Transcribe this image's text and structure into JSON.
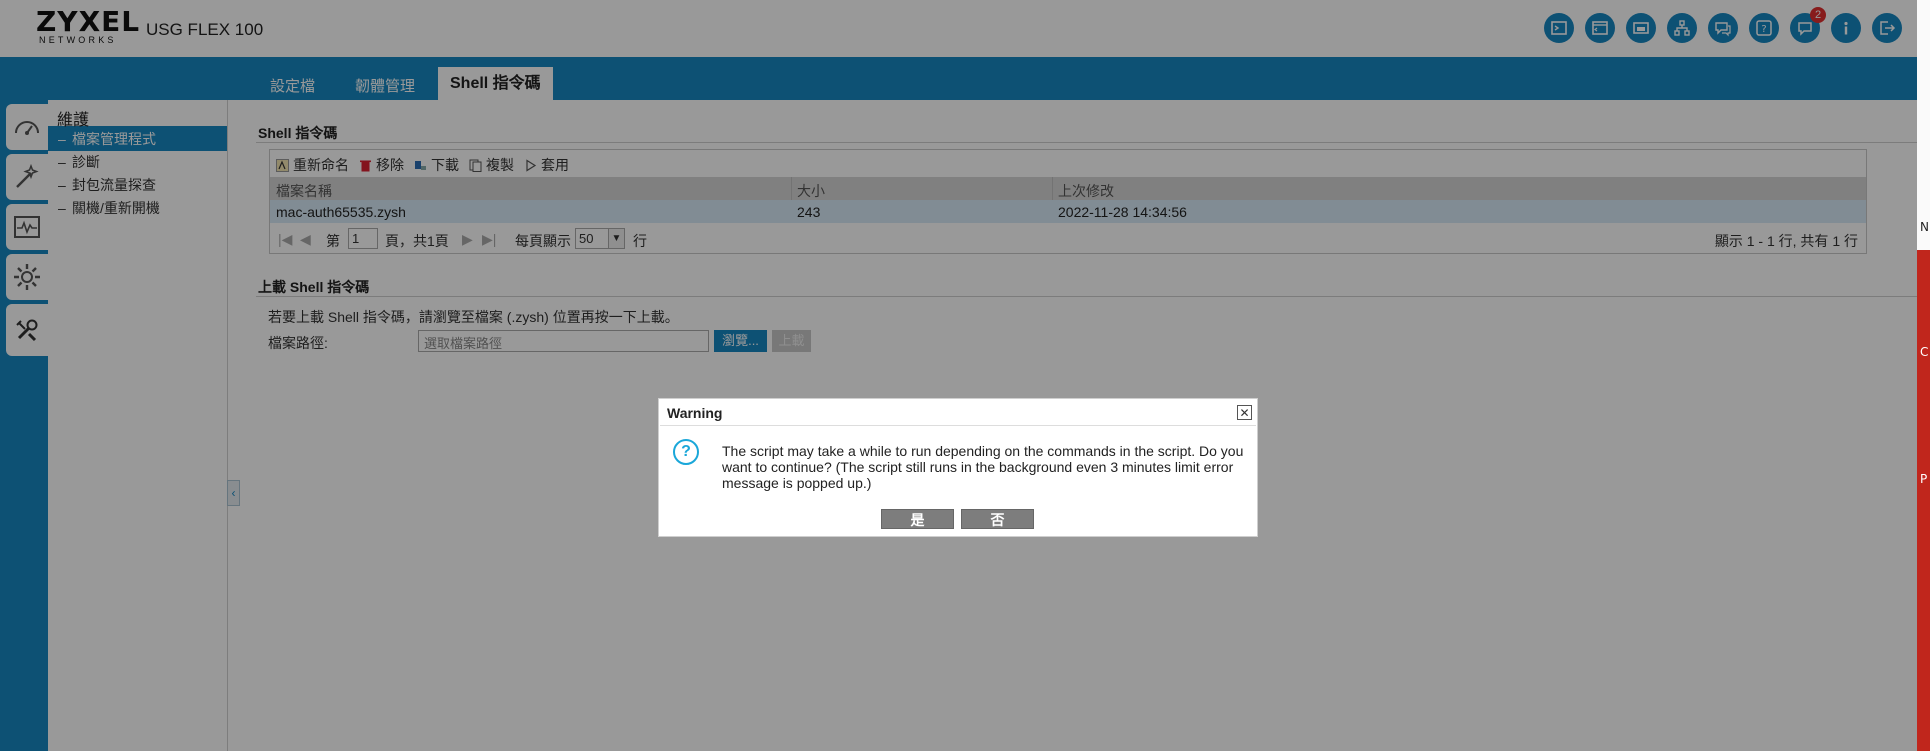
{
  "header": {
    "brand": "ZYXEL",
    "brand_sub": "NETWORKS",
    "model": "USG FLEX 100",
    "notification_count": "2",
    "icons": [
      "console-icon",
      "cli-icon",
      "window-icon",
      "network-icon",
      "chat-icon",
      "help-icon",
      "notification-icon",
      "info-icon",
      "logout-icon"
    ]
  },
  "tabs": [
    {
      "label": "設定檔"
    },
    {
      "label": "韌體管理"
    },
    {
      "label": "Shell 指令碼"
    }
  ],
  "sidebar": {
    "title": "維護",
    "items": [
      {
        "label": "檔案管理程式",
        "active": true
      },
      {
        "label": "診斷"
      },
      {
        "label": "封包流量探查"
      },
      {
        "label": "關機/重新開機"
      }
    ],
    "rail_icons": [
      "dashboard-icon",
      "wizard-icon",
      "monitor-icon",
      "settings-icon",
      "maintenance-icon"
    ]
  },
  "shell_section": {
    "title": "Shell 指令碼",
    "toolbar": {
      "rename": "重新命名",
      "remove": "移除",
      "download": "下載",
      "copy": "複製",
      "apply": "套用"
    },
    "columns": [
      "檔案名稱",
      "大小",
      "上次修改"
    ],
    "rows": [
      {
        "name": "mac-auth65535.zysh",
        "size": "243",
        "modified": "2022-11-28 14:34:56"
      }
    ],
    "pager": {
      "page_label": "第",
      "page_value": "1",
      "page_suffix": "頁，共1頁",
      "per_page_label": "每頁顯示",
      "per_page_value": "50",
      "per_page_suffix": "行",
      "summary": "顯示 1 - 1 行, 共有 1 行"
    }
  },
  "upload_section": {
    "title": "上載 Shell 指令碼",
    "description": "若要上載 Shell 指令碼，請瀏覽至檔案 (.zysh) 位置再按一下上載。",
    "path_label": "檔案路徑:",
    "path_placeholder": "選取檔案路徑",
    "browse_label": "瀏覽...",
    "upload_label": "上載"
  },
  "dialog": {
    "title": "Warning",
    "message": "The script may take a while to run depending on the commands in the script. Do you want to continue? (The script still runs in the background even 3 minutes limit error message is popped up.)",
    "yes_label": "是",
    "no_label": "否"
  },
  "right_edge": {
    "char1": "N",
    "char2": "C",
    "char3": "P"
  },
  "colors": {
    "accent": "#1787c2",
    "overlay": "#666666",
    "dialog_button": "#7d7d7d"
  }
}
